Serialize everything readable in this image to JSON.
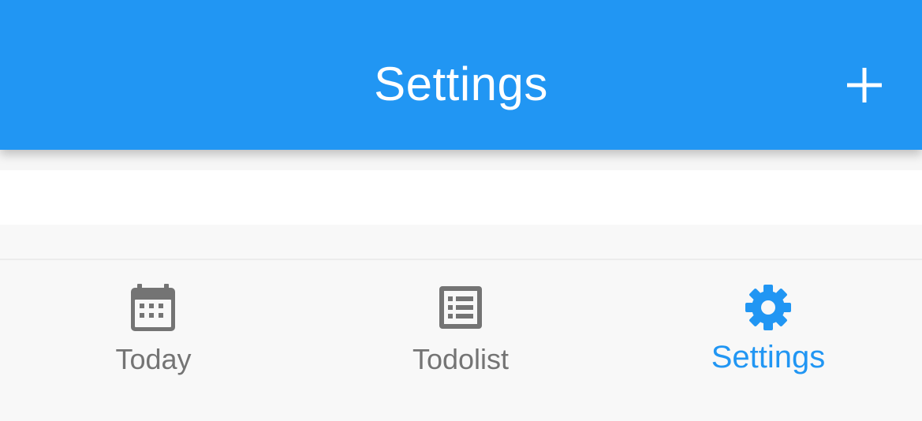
{
  "app_bar": {
    "title": "Settings",
    "add_icon": "plus-icon"
  },
  "bottom_nav": {
    "items": [
      {
        "label": "Today",
        "icon": "calendar-icon",
        "active": false
      },
      {
        "label": "Todolist",
        "icon": "list-icon",
        "active": false
      },
      {
        "label": "Settings",
        "icon": "gear-icon",
        "active": true
      }
    ]
  },
  "colors": {
    "primary": "#2196f3",
    "inactive": "#747474",
    "nav_background": "#f8f8f8"
  }
}
